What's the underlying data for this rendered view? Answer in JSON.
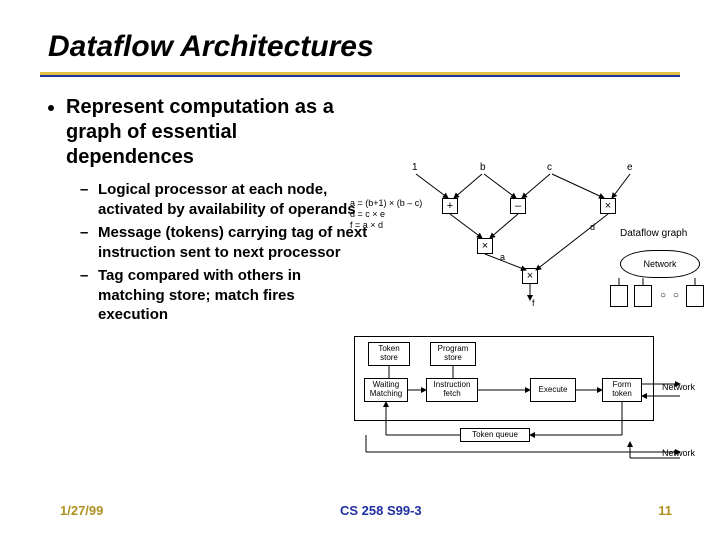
{
  "title": "Dataflow Architectures",
  "main_bullet": "Represent computation as a graph of essential dependences",
  "subs": [
    "Logical processor at each node, activated by availability of operands",
    "Message (tokens) carrying tag of next instruction sent to next processor",
    "Tag compared with others in matching store; match fires execution"
  ],
  "eq1": "a = (b+1) × (b – c)",
  "eq2": "d = c × e",
  "eq3": "f = a × d",
  "graph": {
    "in1": "1",
    "inb": "b",
    "inc": "c",
    "ine": "e",
    "plus": "+",
    "minus": "–",
    "times": "×",
    "a": "a",
    "d": "d",
    "f": "f",
    "dflabel": "Dataflow graph",
    "net": "Network",
    "dots": "○ ○ ○"
  },
  "diagram": {
    "ts": "Token\nstore",
    "ps": "Program\nstore",
    "wm": "Waiting\nMatching",
    "if": "Instruction\nfetch",
    "ex": "Execute",
    "ft": "Form\ntoken",
    "tq": "Token queue",
    "net": "Network"
  },
  "footer": {
    "left": "1/27/99",
    "center": "CS 258 S99-3",
    "right": "11"
  }
}
